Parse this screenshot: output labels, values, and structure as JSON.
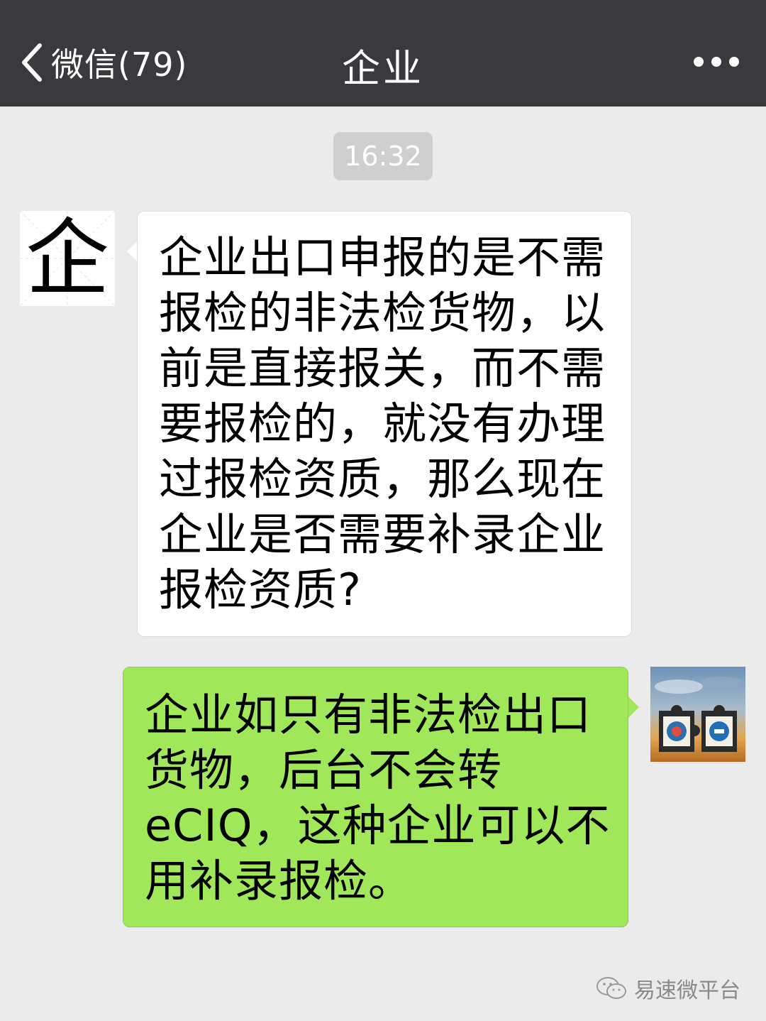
{
  "header": {
    "back_label": "微信(79)",
    "title": "企业",
    "back_icon": "chevron-left-icon",
    "more_icon": "more-dots-icon"
  },
  "chat": {
    "timestamp": "16:32",
    "messages": [
      {
        "side": "left",
        "avatar_char": "企",
        "text": "企业出口申报的是不需\n报检的非法检货物，以\n前是直接报关，而不需\n要报检的，就没有办理\n过报检资质，那么现在\n企业是否需要补录企业\n报检资质?"
      },
      {
        "side": "right",
        "avatar": "puzzle-logo-avatar",
        "text": "企业如只有非法检出口\n货物，后台不会转\neCIQ，这种企业可以不\n用补录报检。"
      }
    ]
  },
  "watermark": {
    "label": "易速微平台",
    "icon": "wechat-icon"
  },
  "colors": {
    "header_bg": "#3a3a3e",
    "chat_bg": "#ebebeb",
    "sent_bubble": "#a0e75a",
    "received_bubble": "#ffffff"
  }
}
